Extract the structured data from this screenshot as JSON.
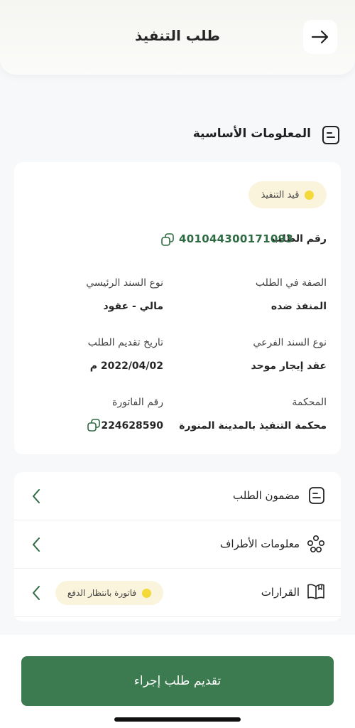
{
  "header": {
    "title": "طلب التنفيذ"
  },
  "section": {
    "title": "المعلومات الأساسية"
  },
  "card": {
    "status": "قيد التنفيذ",
    "request_number_label": "رقم الطلب",
    "request_number": "401044300171093",
    "capacity_label": "الصفة في الطلب",
    "capacity_value": "المنفذ ضده",
    "main_bond_label": "نوع السند الرئيسي",
    "main_bond_value": "مالي - عقود",
    "sub_bond_label": "نوع السند الفرعي",
    "sub_bond_value": "عقد إيجار موحد",
    "submit_date_label": "تاريخ تقديم الطلب",
    "submit_date_value": "2022/04/02 م",
    "court_label": "المحكمة",
    "court_value": "محكمة التنفيذ بالمدينة المنورة",
    "invoice_label": "رقم الفاتورة",
    "invoice_value": "224628590"
  },
  "list": {
    "items": [
      {
        "label": "مضمون الطلب"
      },
      {
        "label": "معلومات الأطراف"
      },
      {
        "label": "القرارات",
        "badge": "فاتورة بانتظار الدفع"
      }
    ]
  },
  "footer": {
    "submit_label": "تقديم طلب إجراء"
  },
  "colors": {
    "accent": "#3c7a50",
    "status_dot": "#f3d93a",
    "status_bg": "#fbf4dc"
  }
}
